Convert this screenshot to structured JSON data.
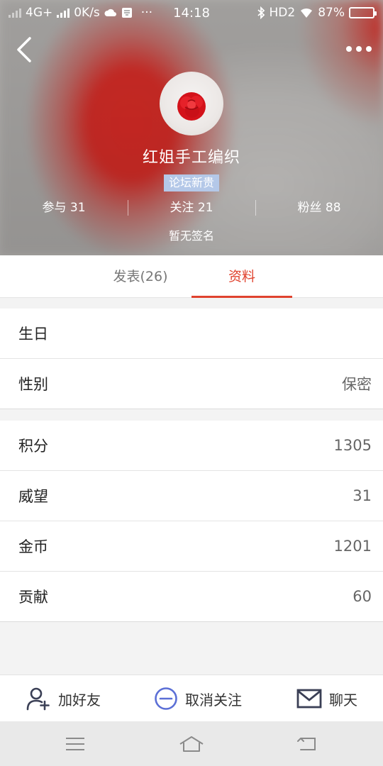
{
  "status_bar": {
    "network": "4G+",
    "speed": "0K/s",
    "time": "14:18",
    "hd": "HD2",
    "battery": "87%",
    "battery_level": 0.87,
    "more": "···"
  },
  "profile": {
    "username": "红姐手工编织",
    "badge": "论坛新贵",
    "stats": [
      {
        "label": "参与",
        "value": "31"
      },
      {
        "label": "关注",
        "value": "21"
      },
      {
        "label": "粉丝",
        "value": "88"
      }
    ],
    "signature": "暂无签名"
  },
  "tabs": [
    {
      "label": "发表(26)",
      "active": false
    },
    {
      "label": "资料",
      "active": true
    }
  ],
  "info_basic": [
    {
      "label": "生日",
      "value": ""
    },
    {
      "label": "性别",
      "value": "保密"
    }
  ],
  "info_points": [
    {
      "label": "积分",
      "value": "1305"
    },
    {
      "label": "威望",
      "value": "31"
    },
    {
      "label": "金币",
      "value": "1201"
    },
    {
      "label": "贡献",
      "value": "60"
    }
  ],
  "actions": {
    "add_friend": "加好友",
    "unfollow": "取消关注",
    "chat": "聊天"
  },
  "colors": {
    "accent": "#e0422e",
    "badge_bg": "#b4c8e8",
    "icon_blue": "#5b6fd6",
    "icon_dark": "#3a3f55"
  },
  "icons": {
    "back": "chevron-left-icon",
    "more": "more-dots-icon",
    "add_friend": "add-user-icon",
    "unfollow": "minus-circle-icon",
    "chat": "envelope-icon",
    "nav_menu": "menu-icon",
    "nav_home": "home-icon",
    "nav_back": "return-icon"
  }
}
